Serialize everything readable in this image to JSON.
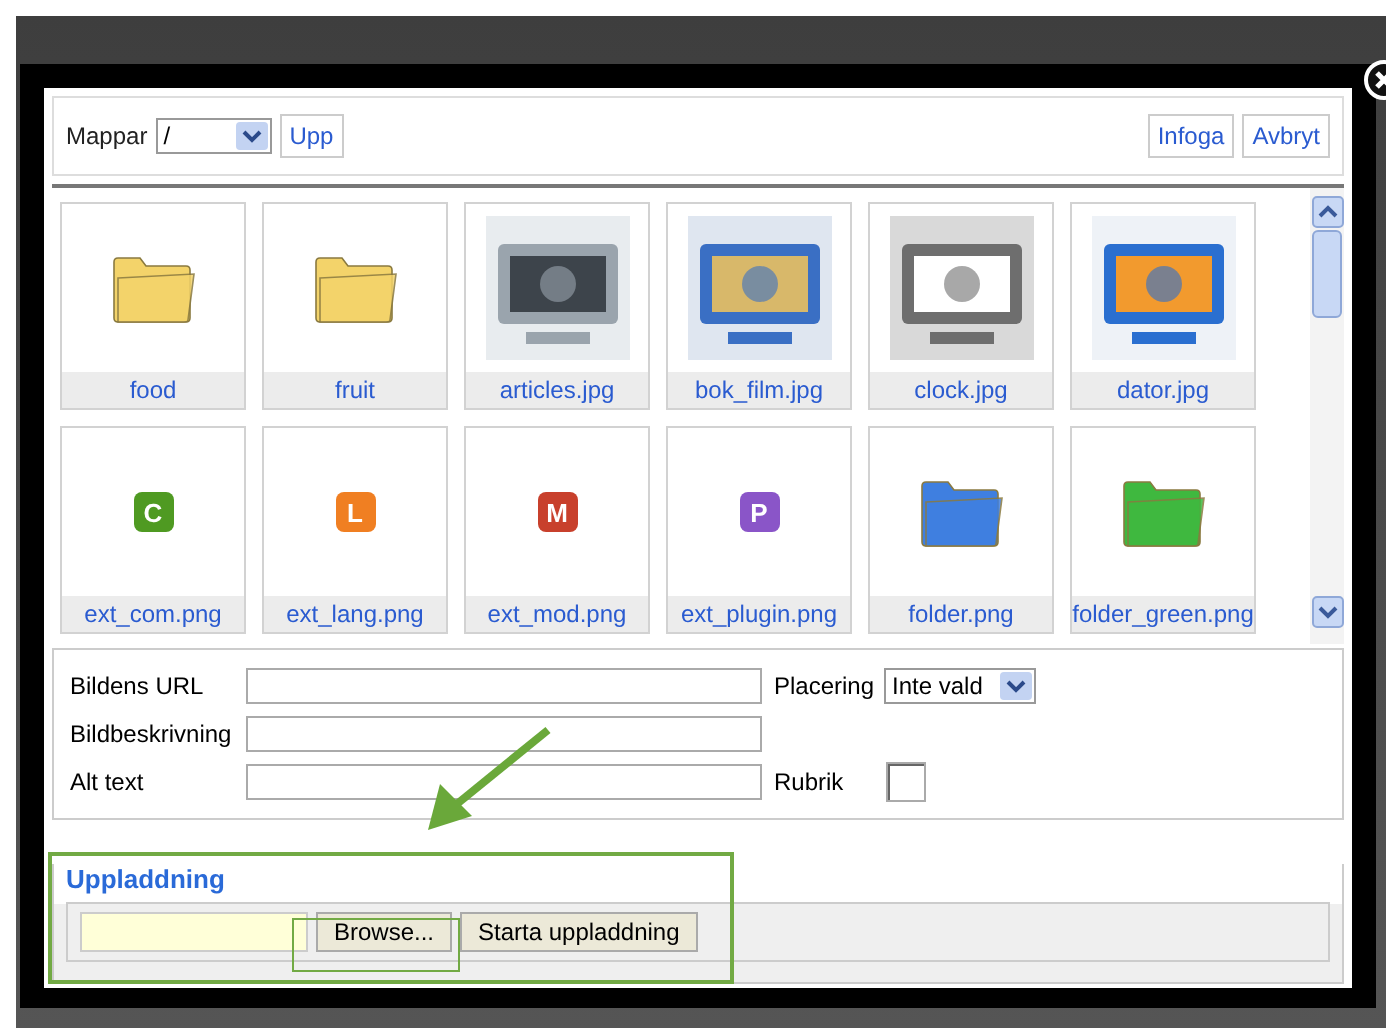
{
  "toolbar": {
    "folder_label": "Mappar",
    "folder_value": "/",
    "up_button": "Upp",
    "insert_button": "Infoga",
    "cancel_button": "Avbryt"
  },
  "files": [
    {
      "name": "food",
      "kind": "folder",
      "color": "#f3d36a"
    },
    {
      "name": "fruit",
      "kind": "folder",
      "color": "#f3d36a"
    },
    {
      "name": "articles.jpg",
      "kind": "picture"
    },
    {
      "name": "bok_film.jpg",
      "kind": "picture"
    },
    {
      "name": "clock.jpg",
      "kind": "picture"
    },
    {
      "name": "dator.jpg",
      "kind": "picture"
    },
    {
      "name": "ext_com.png",
      "kind": "badge",
      "letter": "C",
      "color": "#4f9a22"
    },
    {
      "name": "ext_lang.png",
      "kind": "badge",
      "letter": "L",
      "color": "#f07f22"
    },
    {
      "name": "ext_mod.png",
      "kind": "badge",
      "letter": "M",
      "color": "#c8402c"
    },
    {
      "name": "ext_plugin.png",
      "kind": "badge",
      "letter": "P",
      "color": "#8a55c8"
    },
    {
      "name": "folder.png",
      "kind": "folder",
      "color": "#3f7fe0"
    },
    {
      "name": "folder_green.png",
      "kind": "folder",
      "color": "#3fb83f"
    }
  ],
  "form": {
    "url_label": "Bildens URL",
    "description_label": "Bildbeskrivning",
    "alt_label": "Alt text",
    "placement_label": "Placering",
    "placement_value": "Inte vald",
    "caption_label": "Rubrik",
    "caption_checked": false
  },
  "upload": {
    "legend": "Uppladdning",
    "browse_button": "Browse...",
    "start_button": "Starta uppladdning"
  }
}
